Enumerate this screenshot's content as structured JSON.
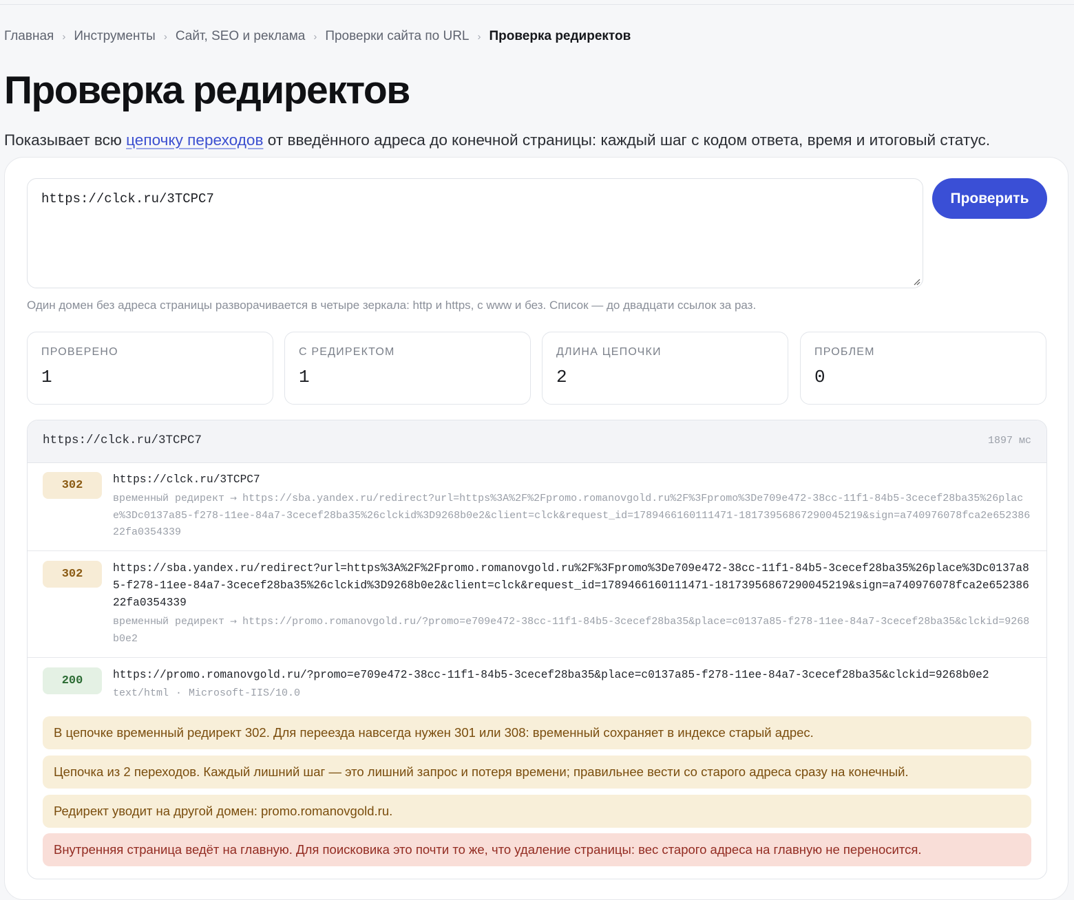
{
  "breadcrumb": {
    "items": [
      "Главная",
      "Инструменты",
      "Сайт, SEO и реклама",
      "Проверки сайта по URL"
    ],
    "current": "Проверка редиректов",
    "separator": "›"
  },
  "page": {
    "title": "Проверка редиректов",
    "lead_before": "Показывает всю ",
    "lead_link": "цепочку переходов",
    "lead_after": " от введённого адреса до конечной страницы: каждый шаг с кодом ответа, время и итоговый статус."
  },
  "form": {
    "url_value": "https://clck.ru/3TCPC7",
    "submit_label": "Проверить",
    "hint": "Один домен без адреса страницы разворачивается в четыре зеркала: http и https, с www и без. Список — до двадцати ссылок за раз."
  },
  "stats": [
    {
      "label": "ПРОВЕРЕНО",
      "value": "1"
    },
    {
      "label": "С РЕДИРЕКТОМ",
      "value": "1"
    },
    {
      "label": "ДЛИНА ЦЕПОЧКИ",
      "value": "2"
    },
    {
      "label": "ПРОБЛЕМ",
      "value": "0"
    }
  ],
  "result": {
    "url": "https://clck.ru/3TCPC7",
    "time": "1897 мс",
    "steps": [
      {
        "code": "302",
        "url": "https://clck.ru/3TCPC7",
        "type": "временный редирект",
        "arrow": "→",
        "target": "https://sba.yandex.ru/redirect?url=https%3A%2F%2Fpromo.romanovgold.ru%2F%3Fpromo%3De709e472-38cc-11f1-84b5-3cecef28ba35%26place%3Dc0137a85-f278-11ee-84a7-3cecef28ba35%26clckid%3D9268b0e2&client=clck&request_id=1789466160111471-18173956867290045219&sign=a740976078fca2e65238622fa0354339"
      },
      {
        "code": "302",
        "url": "https://sba.yandex.ru/redirect?url=https%3A%2F%2Fpromo.romanovgold.ru%2F%3Fpromo%3De709e472-38cc-11f1-84b5-3cecef28ba35%26place%3Dc0137a85-f278-11ee-84a7-3cecef28ba35%26clckid%3D9268b0e2&client=clck&request_id=1789466160111471-18173956867290045219&sign=a740976078fca2e65238622fa0354339",
        "type": "временный редирект",
        "arrow": "→",
        "target": "https://promo.romanovgold.ru/?promo=e709e472-38cc-11f1-84b5-3cecef28ba35&place=c0137a85-f278-11ee-84a7-3cecef28ba35&clckid=9268b0e2"
      },
      {
        "code": "200",
        "url": "https://promo.romanovgold.ru/?promo=e709e472-38cc-11f1-84b5-3cecef28ba35&place=c0137a85-f278-11ee-84a7-3cecef28ba35&clckid=9268b0e2",
        "content_type": "text/html",
        "dot": "·",
        "server": "Microsoft-IIS/10.0"
      }
    ],
    "notes": [
      {
        "level": "warning",
        "text": "В цепочке временный редирект 302. Для переезда навсегда нужен 301 или 308: временный сохраняет в индексе старый адрес."
      },
      {
        "level": "warning",
        "text": "Цепочка из 2 переходов. Каждый лишний шаг — это лишний запрос и потеря времени; правильнее вести со старого адреса сразу на конечный."
      },
      {
        "level": "warning",
        "text": "Редирект уводит на другой домен: promo.romanovgold.ru."
      },
      {
        "level": "error",
        "text": "Внутренняя страница ведёт на главную. Для поисковика это почти то же, что удаление страницы: вес старого адреса на главную не переносится."
      }
    ]
  },
  "colors": {
    "accent": "#3a4fd6",
    "redirect_badge": "#f7ecd6",
    "ok_badge": "#e4f1e4",
    "warning_note": "#f8efd9",
    "error_note": "#f9ded8"
  }
}
